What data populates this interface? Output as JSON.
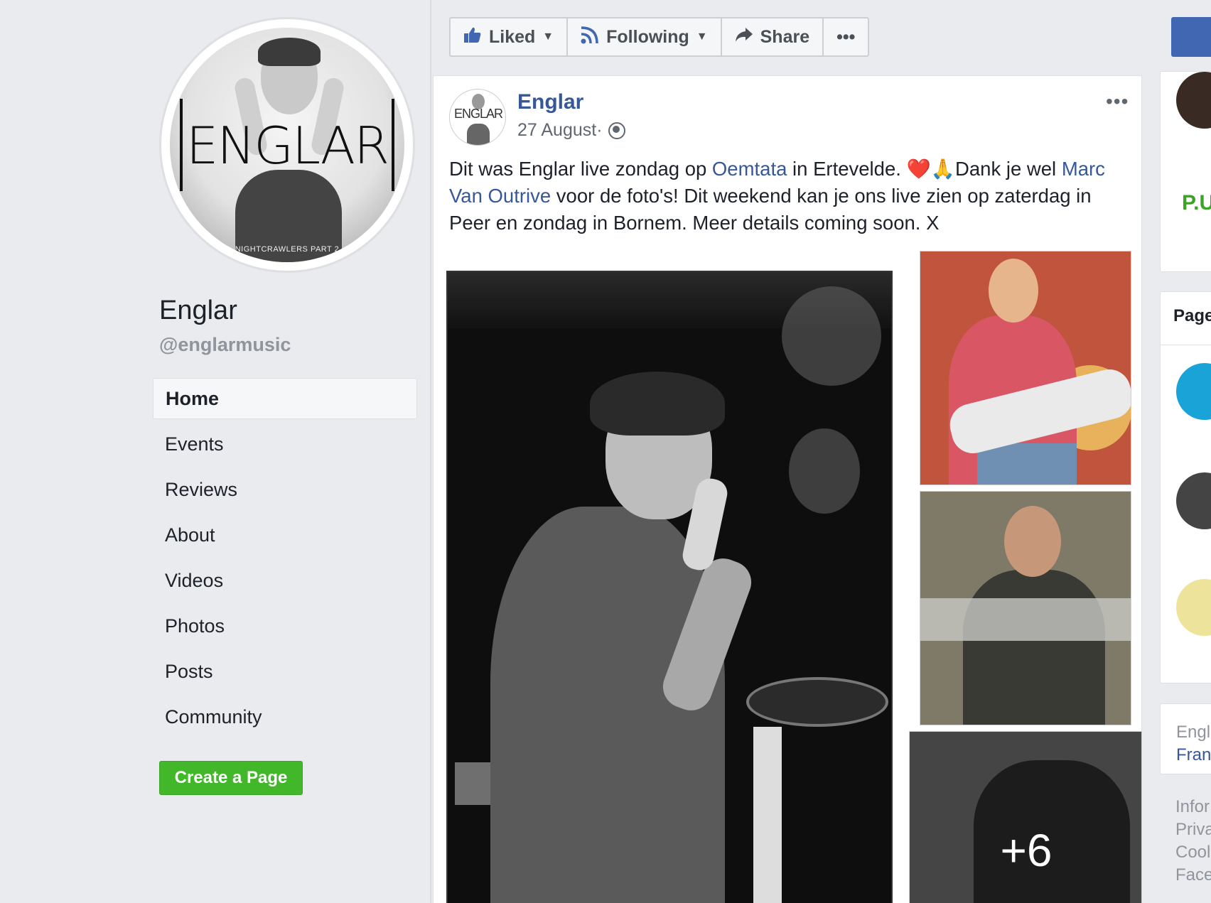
{
  "profile": {
    "logo_text": "ENGLAR",
    "caption": "NIGHTCRAWLERS PART 2",
    "name": "Englar",
    "handle": "@englarmusic"
  },
  "nav": {
    "items": [
      "Home",
      "Events",
      "Reviews",
      "About",
      "Videos",
      "Photos",
      "Posts",
      "Community"
    ],
    "active": "Home",
    "create_page": "Create a Page"
  },
  "toolbar": {
    "liked": "Liked",
    "following": "Following",
    "share": "Share",
    "more": "•••"
  },
  "post": {
    "author": "Englar",
    "date": "27 August",
    "meta_sep": " · ",
    "more": "•••",
    "text_part1": "Dit was Englar live zondag op ",
    "link1": "Oemtata",
    "text_part2": " in Ertevelde. ❤️🙏Dank je wel ",
    "link2": "Marc Van Outrive",
    "text_part3": " voor de foto's! Dit weekend kan je ons live zien op zaterdag in Peer en zondag in Bornem. Meer details coming soon. X",
    "photo_more_count": "+6",
    "avatar_text": "ENGLAR"
  },
  "right": {
    "card1_logo": "P.U",
    "card2_title": "Page",
    "card3_line1": "Engl",
    "card3_line2": "Fran",
    "footer_links": [
      "Infor",
      "Priva",
      "Cool",
      "Face"
    ]
  },
  "colors": {
    "link": "#365899",
    "create_page_green": "#42b72a",
    "brand_blue": "#4267b2",
    "page_bg": "#e9ebee"
  },
  "icons": {
    "liked": "thumbs-up-icon",
    "following": "rss-feed-icon",
    "share": "share-arrow-icon",
    "privacy": "globe-icon",
    "dropdown": "caret-down-icon"
  }
}
